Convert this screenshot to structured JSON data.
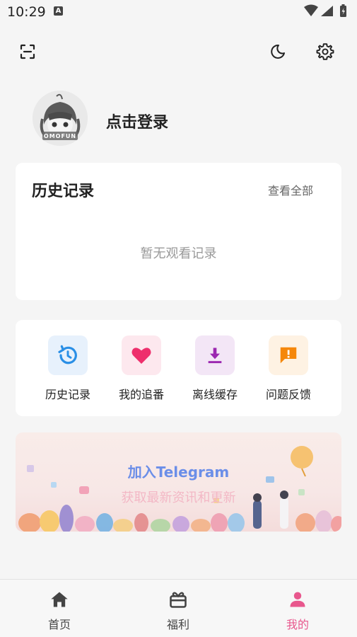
{
  "status_bar": {
    "time": "10:29",
    "notif_icon": "text-a-icon"
  },
  "topbar": {
    "left_icon": "scan-icon",
    "right_icons": [
      "moon-icon",
      "gear-icon"
    ]
  },
  "profile": {
    "avatar_text": "OMOFUN",
    "login_label": "点击登录"
  },
  "history": {
    "title": "历史记录",
    "view_all": "查看全部",
    "empty_text": "暂无观看记录"
  },
  "quick_actions": [
    {
      "label": "历史记录",
      "icon": "history-icon",
      "bg": "#e7f1fc",
      "color": "#2a8fe6"
    },
    {
      "label": "我的追番",
      "icon": "heart-icon",
      "bg": "#fde8ee",
      "color": "#ee2f6c"
    },
    {
      "label": "离线缓存",
      "icon": "download-icon",
      "bg": "#f3e6f6",
      "color": "#9b27b0"
    },
    {
      "label": "问题反馈",
      "icon": "feedback-icon",
      "bg": "#fef2e3",
      "color": "#f5870a"
    }
  ],
  "banner": {
    "title": "加入Telegram",
    "subtitle": "获取最新资讯和更新"
  },
  "bottom_nav": [
    {
      "label": "首页",
      "icon": "home-icon"
    },
    {
      "label": "福利",
      "icon": "gift-icon"
    },
    {
      "label": "我的",
      "icon": "person-icon",
      "active": true
    }
  ],
  "colors": {
    "accent": "#e8578d",
    "banner_title": "#6b8ee8"
  }
}
